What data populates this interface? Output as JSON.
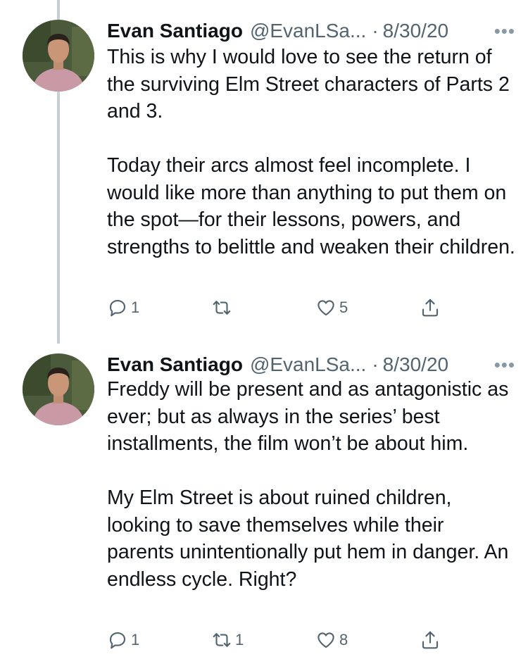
{
  "tweets": [
    {
      "name": "Evan Santiago",
      "handle": "@EvanLSa...",
      "separator": "·",
      "date": "8/30/20",
      "more_icon": "more-horizontal-icon",
      "paragraphs": [
        "This is why I would love to see the return of the surviving Elm Street characters of Parts 2 and 3.",
        "Today their arcs almost feel incomplete. I would like more than anything to put them on the spot—for their lessons, powers, and strengths to belittle and weaken their children."
      ],
      "replies": "1",
      "retweets": "",
      "likes": "5"
    },
    {
      "name": "Evan Santiago",
      "handle": "@EvanLSa...",
      "separator": "·",
      "date": "8/30/20",
      "more_icon": "more-horizontal-icon",
      "paragraphs": [
        "Freddy will be present and as antagonistic as ever; but as always in the series’ best installments, the film won’t be about him.",
        "My Elm Street is about ruined children, looking to save themselves while their parents unintentionally put hem in danger. An endless cycle. Right?"
      ],
      "replies": "1",
      "retweets": "1",
      "likes": "8"
    }
  ],
  "colors": {
    "text": "#0f1419",
    "secondary": "#536471",
    "thread_line": "#c4cfd6"
  }
}
